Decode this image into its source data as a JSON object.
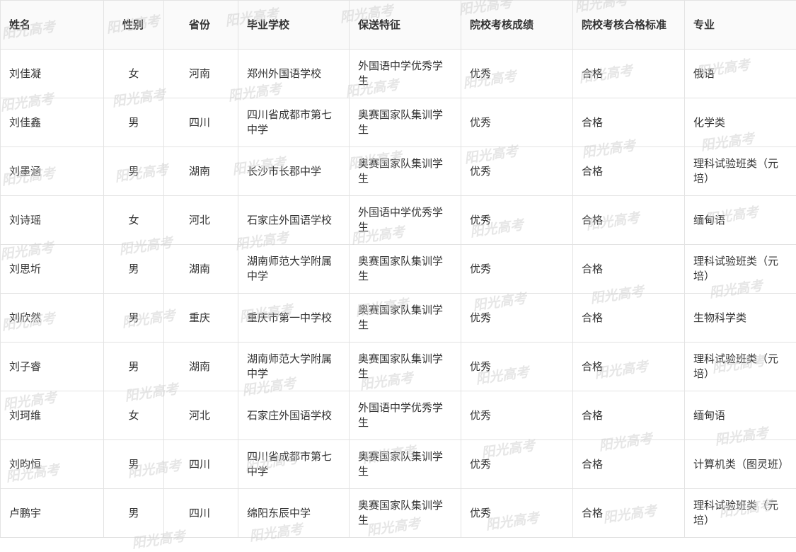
{
  "watermark": "阳光高考",
  "headers": [
    "姓名",
    "性别",
    "省份",
    "毕业学校",
    "保送特征",
    "院校考核成绩",
    "院校考核合格标准",
    "专业"
  ],
  "rows": [
    [
      "刘佳凝",
      "女",
      "河南",
      "郑州外国语学校",
      "外国语中学优秀学生",
      "优秀",
      "合格",
      "俄语"
    ],
    [
      "刘佳鑫",
      "男",
      "四川",
      "四川省成都市第七中学",
      "奥赛国家队集训学生",
      "优秀",
      "合格",
      "化学类"
    ],
    [
      "刘墨涵",
      "男",
      "湖南",
      "长沙市长郡中学",
      "奥赛国家队集训学生",
      "优秀",
      "合格",
      "理科试验班类（元培）"
    ],
    [
      "刘诗瑶",
      "女",
      "河北",
      "石家庄外国语学校",
      "外国语中学优秀学生",
      "优秀",
      "合格",
      "缅甸语"
    ],
    [
      "刘思圻",
      "男",
      "湖南",
      "湖南师范大学附属中学",
      "奥赛国家队集训学生",
      "优秀",
      "合格",
      "理科试验班类（元培）"
    ],
    [
      "刘欣然",
      "男",
      "重庆",
      "重庆市第一中学校",
      "奥赛国家队集训学生",
      "优秀",
      "合格",
      "生物科学类"
    ],
    [
      "刘子睿",
      "男",
      "湖南",
      "湖南师范大学附属中学",
      "奥赛国家队集训学生",
      "优秀",
      "合格",
      "理科试验班类（元培）"
    ],
    [
      "刘珂维",
      "女",
      "河北",
      "石家庄外国语学校",
      "外国语中学优秀学生",
      "优秀",
      "合格",
      "缅甸语"
    ],
    [
      "刘昀恒",
      "男",
      "四川",
      "四川省成都市第七中学",
      "奥赛国家队集训学生",
      "优秀",
      "合格",
      "计算机类（图灵班）"
    ],
    [
      "卢鹏宇",
      "男",
      "四川",
      "绵阳东辰中学",
      "奥赛国家队集训学生",
      "优秀",
      "合格",
      "理科试验班类（元培）"
    ]
  ]
}
